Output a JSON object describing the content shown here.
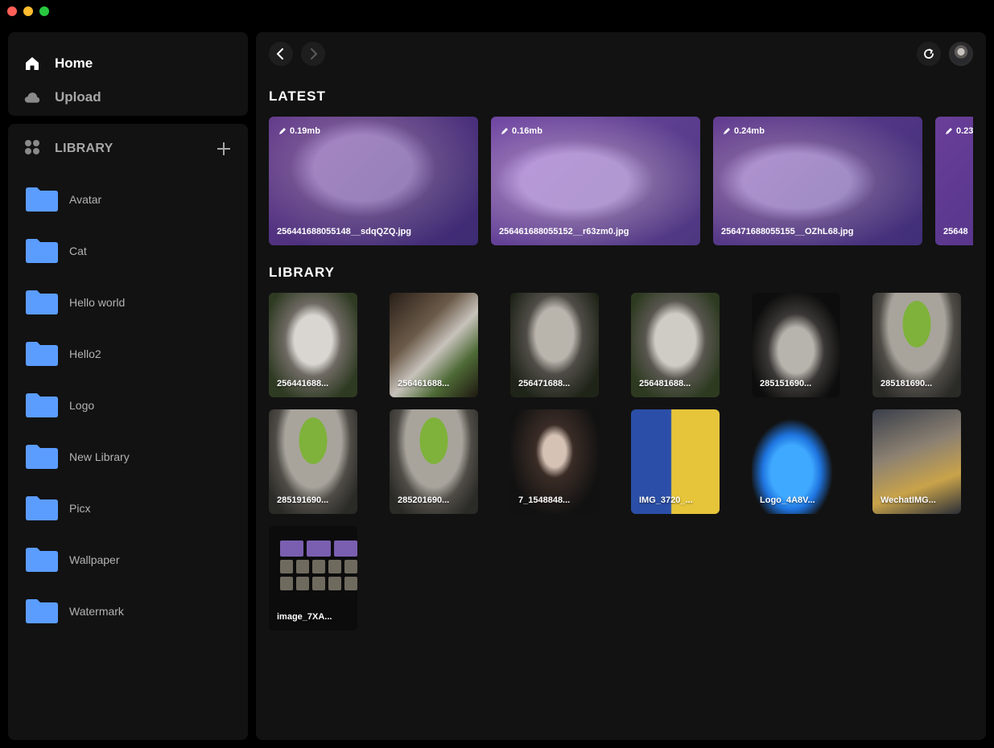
{
  "window": {
    "controls": [
      "close",
      "minimize",
      "maximize"
    ]
  },
  "nav": {
    "items": [
      {
        "label": "Home",
        "icon": "home-icon",
        "active": true
      },
      {
        "label": "Upload",
        "icon": "cloud-icon",
        "active": false
      }
    ]
  },
  "library_sidebar": {
    "title": "LIBRARY",
    "folders": [
      {
        "name": "Avatar"
      },
      {
        "name": "Cat"
      },
      {
        "name": "Hello world"
      },
      {
        "name": "Hello2"
      },
      {
        "name": "Logo"
      },
      {
        "name": "New Library"
      },
      {
        "name": "Picx"
      },
      {
        "name": "Wallpaper"
      },
      {
        "name": "Watermark"
      }
    ],
    "folder_color": "#5b9cff"
  },
  "main": {
    "latest_title": "LATEST",
    "library_title": "LIBRARY",
    "latest": [
      {
        "size": "0.19mb",
        "filename": "256441688055148__sdqQZQ.jpg"
      },
      {
        "size": "0.16mb",
        "filename": "256461688055152__r63zm0.jpg"
      },
      {
        "size": "0.24mb",
        "filename": "256471688055155__OZhL68.jpg"
      },
      {
        "size": "0.23",
        "filename": "25648"
      }
    ],
    "library": [
      {
        "label": "256441688..."
      },
      {
        "label": "256461688..."
      },
      {
        "label": "256471688..."
      },
      {
        "label": "256481688..."
      },
      {
        "label": "285151690..."
      },
      {
        "label": "285181690..."
      },
      {
        "label": "285191690..."
      },
      {
        "label": "285201690..."
      },
      {
        "label": "7_1548848..."
      },
      {
        "label": "IMG_3720_..."
      },
      {
        "label": "Logo_4A8V..."
      },
      {
        "label": "WechatIMG..."
      },
      {
        "label": "image_7XA..."
      }
    ]
  }
}
